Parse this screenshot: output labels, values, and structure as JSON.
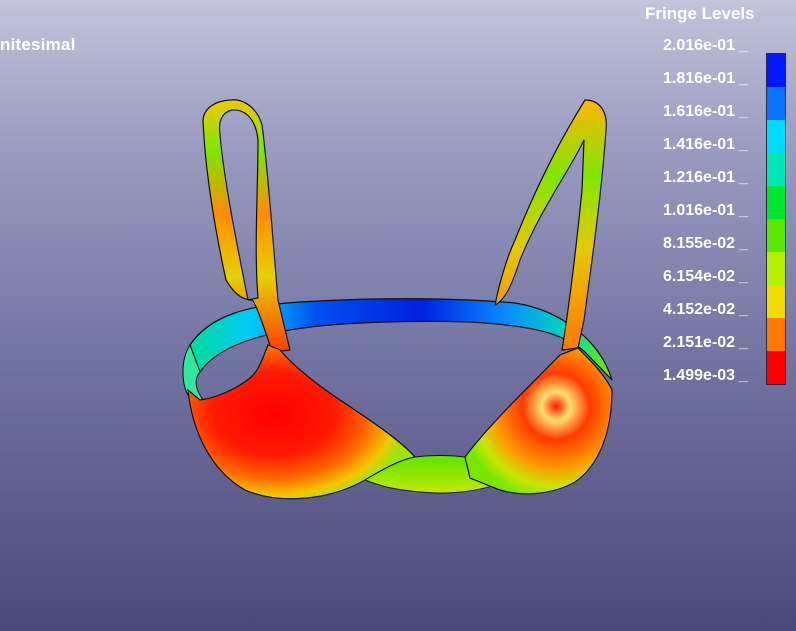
{
  "viewport": {
    "header_text": "nitesimal"
  },
  "legend": {
    "title": "Fringe Levels",
    "labels": [
      "2.016e-01",
      "1.816e-01",
      "1.616e-01",
      "1.416e-01",
      "1.216e-01",
      "1.016e-01",
      "8.155e-02",
      "6.154e-02",
      "4.152e-02",
      "2.151e-02",
      "1.499e-03"
    ],
    "colors": [
      "#0018ff",
      "#0a74ff",
      "#00dcff",
      "#00e6b4",
      "#00e62e",
      "#5ae600",
      "#b4f000",
      "#f0dc00",
      "#ff7800",
      "#ff0000"
    ]
  }
}
